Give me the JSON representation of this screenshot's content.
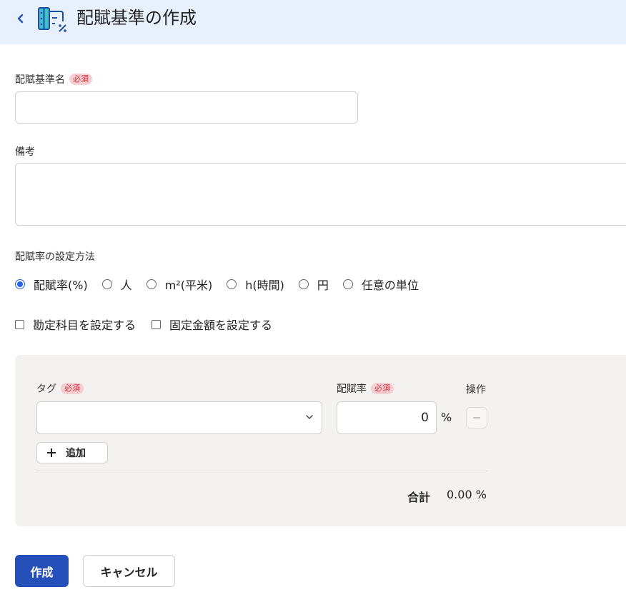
{
  "header": {
    "title": "配賦基準の作成",
    "back_icon": "chevron-left-icon",
    "page_icon": "allocation-table-icon",
    "accent_color": "#2563eb"
  },
  "form": {
    "name_label": "配賦基準名",
    "required_badge": "必須",
    "name_value": "",
    "note_label": "備考",
    "note_value": "",
    "method_label": "配賦率の設定方法",
    "method_options": [
      "配賦率(%)",
      "人",
      "m²(平米)",
      "h(時間)",
      "円",
      "任意の単位"
    ],
    "method_selected": "配賦率(%)",
    "checkboxes": [
      {
        "label": "勘定科目を設定する",
        "checked": false
      },
      {
        "label": "固定金額を設定する",
        "checked": false
      }
    ]
  },
  "allocation_table": {
    "tag_header": "タグ",
    "rate_header": "配賦率",
    "action_header": "操作",
    "rows": [
      {
        "tag": "",
        "rate": "0",
        "unit": "%"
      }
    ],
    "add_label": "追加",
    "total_label": "合計",
    "total_value": "0.00 %"
  },
  "actions": {
    "create_label": "作成",
    "cancel_label": "キャンセル",
    "create_color": "#2550b9"
  }
}
